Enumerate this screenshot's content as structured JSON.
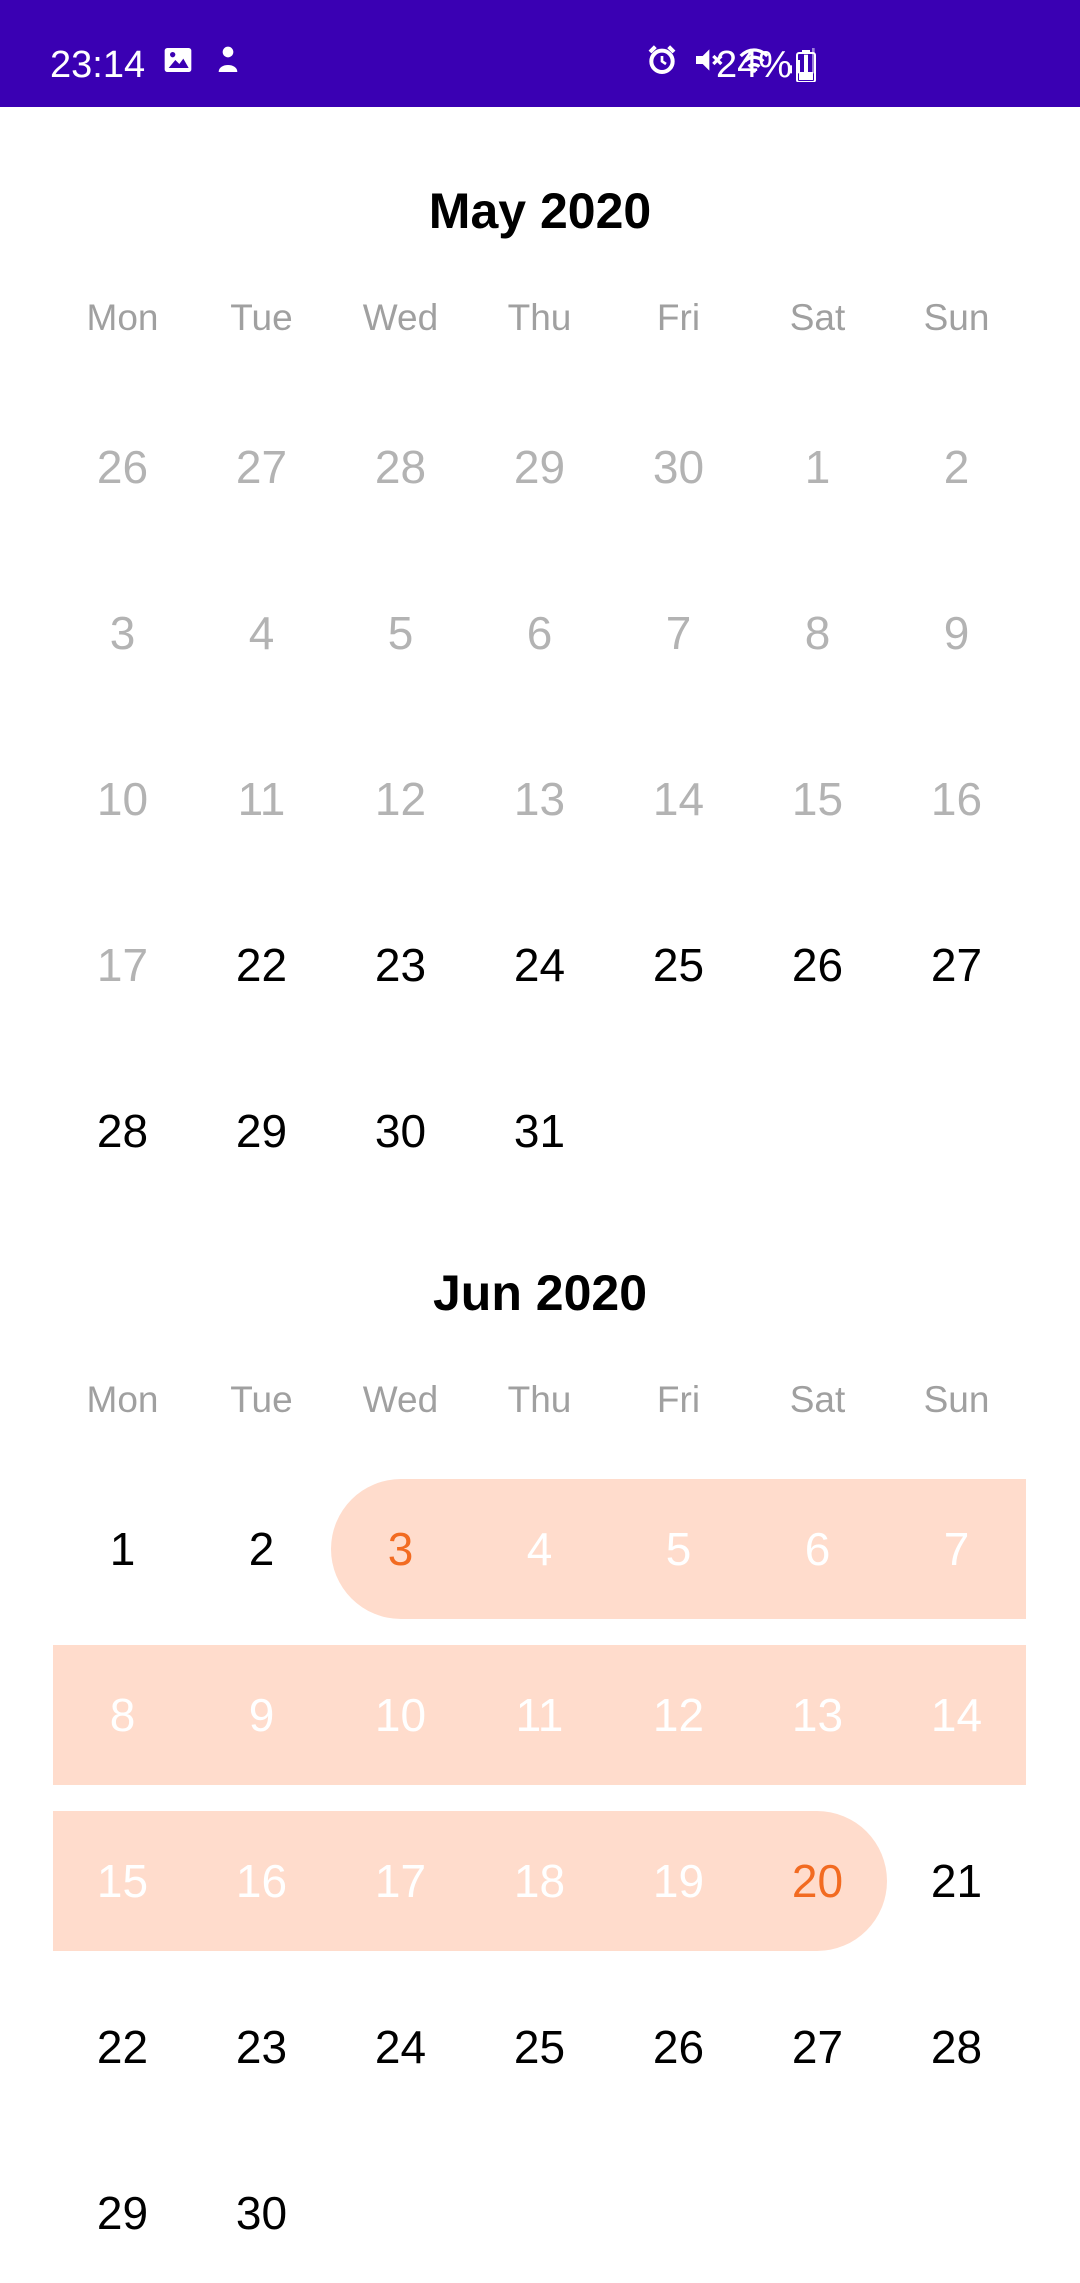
{
  "status_bar": {
    "time": "23:14",
    "battery": "24%",
    "left_icons": [
      "image-icon",
      "notification-person-icon"
    ],
    "right_icons": [
      "alarm-icon",
      "mute-icon",
      "wifi-icon",
      "signal-icon"
    ],
    "background": "#3a00b3"
  },
  "colors": {
    "range_fill": "#ffdccc",
    "endpoint_text": "#f26b21",
    "muted_text": "#b3b3b3"
  },
  "weekdays": [
    "Mon",
    "Tue",
    "Wed",
    "Thu",
    "Fri",
    "Sat",
    "Sun"
  ],
  "months": [
    {
      "title": "May 2020",
      "weeks": [
        [
          {
            "d": "26",
            "s": "muted"
          },
          {
            "d": "27",
            "s": "muted"
          },
          {
            "d": "28",
            "s": "muted"
          },
          {
            "d": "29",
            "s": "muted"
          },
          {
            "d": "30",
            "s": "muted"
          },
          {
            "d": "1",
            "s": "muted"
          },
          {
            "d": "2",
            "s": "muted"
          }
        ],
        [
          {
            "d": "3",
            "s": "muted"
          },
          {
            "d": "4",
            "s": "muted"
          },
          {
            "d": "5",
            "s": "muted"
          },
          {
            "d": "6",
            "s": "muted"
          },
          {
            "d": "7",
            "s": "muted"
          },
          {
            "d": "8",
            "s": "muted"
          },
          {
            "d": "9",
            "s": "muted"
          }
        ],
        [
          {
            "d": "10",
            "s": "muted"
          },
          {
            "d": "11",
            "s": "muted"
          },
          {
            "d": "12",
            "s": "muted"
          },
          {
            "d": "13",
            "s": "muted"
          },
          {
            "d": "14",
            "s": "muted"
          },
          {
            "d": "15",
            "s": "muted"
          },
          {
            "d": "16",
            "s": "muted"
          }
        ],
        [
          {
            "d": "17",
            "s": "muted"
          },
          {
            "d": "22",
            "s": "normal"
          },
          {
            "d": "23",
            "s": "normal"
          },
          {
            "d": "24",
            "s": "normal"
          },
          {
            "d": "25",
            "s": "normal"
          },
          {
            "d": "26",
            "s": "normal"
          },
          {
            "d": "27",
            "s": "normal"
          }
        ],
        [
          {
            "d": "28",
            "s": "normal"
          },
          {
            "d": "29",
            "s": "normal"
          },
          {
            "d": "30",
            "s": "normal"
          },
          {
            "d": "31",
            "s": "normal"
          },
          null,
          null,
          null
        ]
      ]
    },
    {
      "title": "Jun 2020",
      "weeks": [
        [
          {
            "d": "1",
            "s": "normal"
          },
          {
            "d": "2",
            "s": "normal"
          },
          {
            "d": "3",
            "s": "start"
          },
          {
            "d": "4",
            "s": "range"
          },
          {
            "d": "5",
            "s": "range"
          },
          {
            "d": "6",
            "s": "range"
          },
          {
            "d": "7",
            "s": "range"
          }
        ],
        [
          {
            "d": "8",
            "s": "range"
          },
          {
            "d": "9",
            "s": "range"
          },
          {
            "d": "10",
            "s": "range"
          },
          {
            "d": "11",
            "s": "range"
          },
          {
            "d": "12",
            "s": "range"
          },
          {
            "d": "13",
            "s": "range"
          },
          {
            "d": "14",
            "s": "range"
          }
        ],
        [
          {
            "d": "15",
            "s": "range"
          },
          {
            "d": "16",
            "s": "range"
          },
          {
            "d": "17",
            "s": "range"
          },
          {
            "d": "18",
            "s": "range"
          },
          {
            "d": "19",
            "s": "range"
          },
          {
            "d": "20",
            "s": "end"
          },
          {
            "d": "21",
            "s": "normal"
          }
        ],
        [
          {
            "d": "22",
            "s": "normal"
          },
          {
            "d": "23",
            "s": "normal"
          },
          {
            "d": "24",
            "s": "normal"
          },
          {
            "d": "25",
            "s": "normal"
          },
          {
            "d": "26",
            "s": "normal"
          },
          {
            "d": "27",
            "s": "normal"
          },
          {
            "d": "28",
            "s": "normal"
          }
        ],
        [
          {
            "d": "29",
            "s": "normal"
          },
          {
            "d": "30",
            "s": "normal"
          },
          null,
          null,
          null,
          null,
          null
        ]
      ]
    }
  ]
}
